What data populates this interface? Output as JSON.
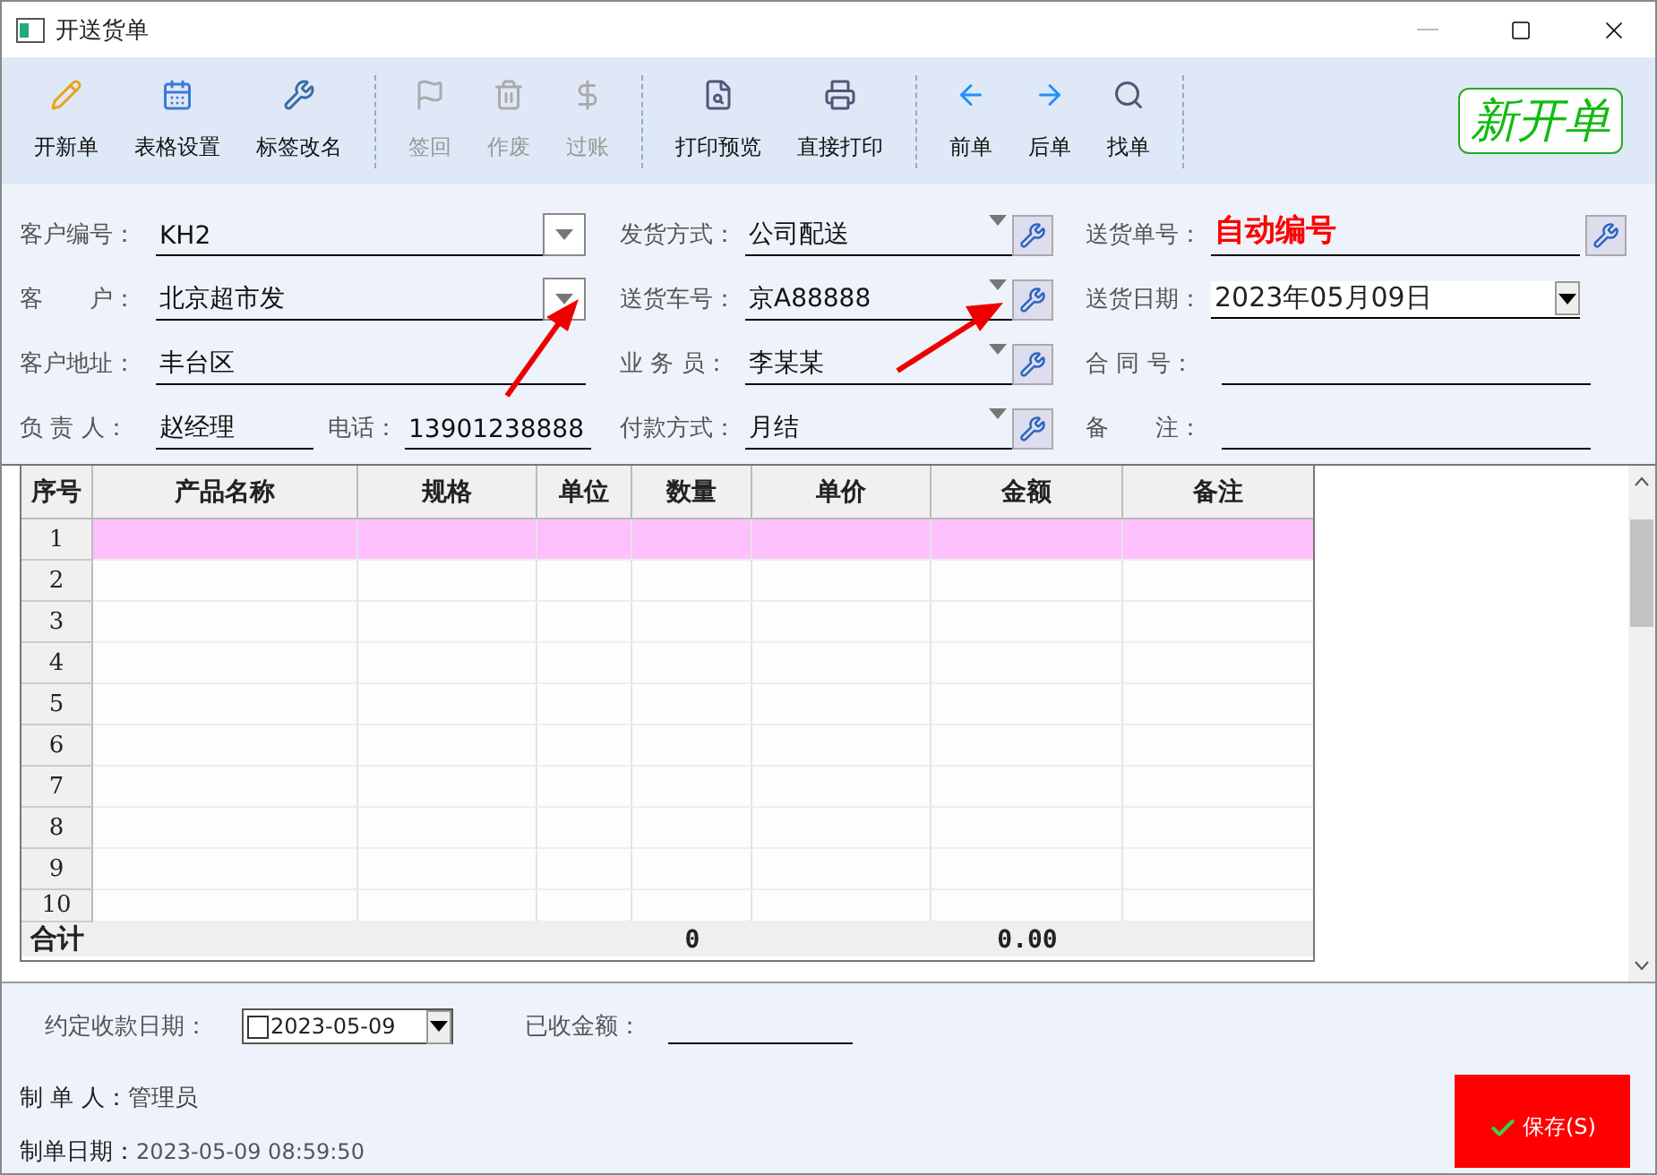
{
  "window": {
    "title": "开送货单"
  },
  "toolbar": [
    {
      "label": "开新单",
      "disabled": false
    },
    {
      "label": "表格设置",
      "disabled": false
    },
    {
      "label": "标签改名",
      "disabled": false
    },
    {
      "label": "签回",
      "disabled": true
    },
    {
      "label": "作废",
      "disabled": true
    },
    {
      "label": "过账",
      "disabled": true
    },
    {
      "label": "打印预览",
      "disabled": false
    },
    {
      "label": "直接打印",
      "disabled": false
    },
    {
      "label": "前单",
      "disabled": false
    },
    {
      "label": "后单",
      "disabled": false
    },
    {
      "label": "找单",
      "disabled": false
    }
  ],
  "new_order_badge": "新开单",
  "form": {
    "left": [
      {
        "kind": "combo",
        "label": "客户编号：",
        "value": "KH2"
      },
      {
        "kind": "combo",
        "label": "客　　户：",
        "value": "北京超市发"
      },
      {
        "kind": "text",
        "label": "客户地址：",
        "value": "丰台区"
      },
      {
        "kind": "pair",
        "label": "负 责 人：",
        "value": "赵经理",
        "label2": "电话：",
        "value2": "13901238888"
      }
    ],
    "middle": [
      {
        "kind": "picker",
        "label": "发货方式：",
        "value": "公司配送"
      },
      {
        "kind": "picker",
        "label": "送货车号：",
        "value": "京A88888"
      },
      {
        "kind": "picker",
        "label": "业 务 员：",
        "value": "李某某"
      },
      {
        "kind": "picker",
        "label": "付款方式：",
        "value": "月结"
      }
    ],
    "right": [
      {
        "kind": "auto",
        "label": "送货单号：",
        "value": "自动编号"
      },
      {
        "kind": "date",
        "label": "送货日期：",
        "value": "2023年05月09日"
      },
      {
        "kind": "text",
        "label": "合 同 号："
      },
      {
        "kind": "text",
        "label": "备　　注："
      }
    ]
  },
  "table": {
    "columns": [
      "序号",
      "产品名称",
      "规格",
      "单位",
      "数量",
      "单价",
      "金额",
      "备注"
    ],
    "rows": [
      {
        "no": "1",
        "selected": true
      },
      {
        "no": "2",
        "selected": false
      },
      {
        "no": "3",
        "selected": false
      },
      {
        "no": "4",
        "selected": false
      },
      {
        "no": "5",
        "selected": false
      },
      {
        "no": "6",
        "selected": false
      },
      {
        "no": "7",
        "selected": false
      },
      {
        "no": "8",
        "selected": false
      },
      {
        "no": "9",
        "selected": false
      },
      {
        "no": "10",
        "selected": false
      }
    ],
    "total": {
      "label": "合计",
      "quantity": "0",
      "amount": "0.00"
    }
  },
  "payment": {
    "label": "约定收款日期：",
    "checked": false,
    "date": "2023-05-09",
    "received_label": "已收金额："
  },
  "creator": {
    "label": "制 单 人：",
    "value": "管理员"
  },
  "created": {
    "label": "制单日期：",
    "value": "2023-05-09 08:59:50"
  },
  "save_button": "保存(S)"
}
